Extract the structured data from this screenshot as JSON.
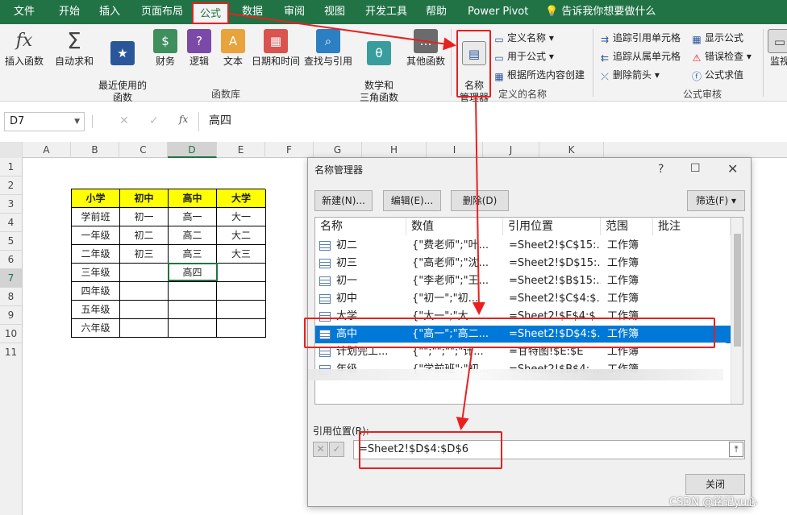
{
  "menu_tabs": [
    "文件",
    "开始",
    "插入",
    "页面布局",
    "公式",
    "数据",
    "审阅",
    "视图",
    "开发工具",
    "帮助",
    "Power Pivot",
    "告诉我你想要做什么"
  ],
  "ribbon": {
    "function_library": [
      "插入函数",
      "自动求和",
      "最近使用的\n函数",
      "财务",
      "逻辑",
      "文本",
      "日期和时间",
      "查找与引用",
      "数学和\n三角函数",
      "其他函数"
    ],
    "function_library_label": "函数库",
    "name_manager": "名称\n管理器",
    "defined_names": [
      "定义名称",
      "用于公式",
      "根据所选内容创建"
    ],
    "defined_names_label": "定义的名称",
    "auditing": [
      "追踪引用单元格",
      "追踪从属单元格",
      "删除箭头",
      "显示公式",
      "错误检查",
      "公式求值"
    ],
    "auditing_label": "公式审核",
    "watch": "监视"
  },
  "formula_bar": {
    "name_box": "D7",
    "fx": "fx",
    "value": "高四"
  },
  "columns": [
    "A",
    "B",
    "C",
    "D",
    "E",
    "F",
    "G",
    "H",
    "I",
    "J",
    "K"
  ],
  "rows": [
    "1",
    "2",
    "3",
    "4",
    "5",
    "6",
    "7",
    "8",
    "9",
    "10",
    "11"
  ],
  "table": {
    "headers": [
      "小学",
      "初中",
      "高中",
      "大学"
    ],
    "rows": [
      [
        "学前班",
        "初一",
        "高一",
        "大一"
      ],
      [
        "一年级",
        "初二",
        "高二",
        "大二"
      ],
      [
        "二年级",
        "初三",
        "高三",
        "大三"
      ],
      [
        "三年级",
        "",
        "高四",
        ""
      ],
      [
        "四年级",
        "",
        "",
        ""
      ],
      [
        "五年级",
        "",
        "",
        ""
      ],
      [
        "六年级",
        "",
        "",
        ""
      ]
    ]
  },
  "dialog": {
    "title": "名称管理器",
    "buttons": {
      "new": "新建(N)...",
      "edit": "编辑(E)...",
      "delete": "删除(D)",
      "filter": "筛选(F)",
      "close": "关闭"
    },
    "columns": [
      "名称",
      "数值",
      "引用位置",
      "范围",
      "批注"
    ],
    "rows": [
      {
        "name": "初二",
        "value": "{\"费老师\";\"叶...",
        "ref": "=Sheet2!$C$15:...",
        "scope": "工作簿"
      },
      {
        "name": "初三",
        "value": "{\"高老师\";\"沈...",
        "ref": "=Sheet2!$D$15:...",
        "scope": "工作簿"
      },
      {
        "name": "初一",
        "value": "{\"李老师\";\"王...",
        "ref": "=Sheet2!$B$15:...",
        "scope": "工作簿"
      },
      {
        "name": "初中",
        "value": "{\"初一\";\"初...",
        "ref": "=Sheet2!$C$4:$...",
        "scope": "工作簿"
      },
      {
        "name": "大学",
        "value": "{\"大一\";\"大...",
        "ref": "=Sheet2!$E$4:$...",
        "scope": "工作簿"
      },
      {
        "name": "高中",
        "value": "{\"高一\";\"高二...",
        "ref": "=Sheet2!$D$4:$...",
        "scope": "工作簿"
      },
      {
        "name": "计划完工...",
        "value": "{\"\";\"\";\"\";\"计...",
        "ref": "=甘特图!$E:$E",
        "scope": "工作簿"
      },
      {
        "name": "年级",
        "value": "{\"学前班\";\"初...",
        "ref": "=Sheet2!$B$4:...",
        "scope": "工作簿"
      }
    ],
    "ref_label": "引用位置(R):",
    "ref_value": "=Sheet2!$D$4:$D$6"
  },
  "watermark": "CSDN @铭记yu心",
  "accent_color": "#217346",
  "highlight_color": "#e8201f"
}
